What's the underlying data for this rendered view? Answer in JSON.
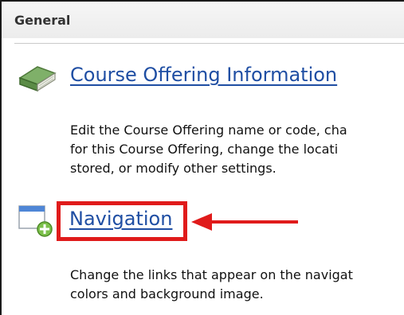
{
  "section": {
    "title": "General"
  },
  "items": [
    {
      "icon": "book-icon",
      "link": "Course Offering Information",
      "description_lines": [
        "Edit the Course Offering name or code, cha",
        "for this Course Offering, change the locati",
        "stored, or modify other settings."
      ]
    },
    {
      "icon": "navigation-window-add-icon",
      "link": "Navigation",
      "description_lines": [
        "Change the links that appear on the navigat",
        "colors and background image."
      ]
    }
  ],
  "annotation": {
    "highlight_color": "#e01b1b",
    "arrow_color": "#e01b1b"
  },
  "colors": {
    "link": "#1f4ea3",
    "text": "#111111",
    "header_bg": "#efefef"
  }
}
